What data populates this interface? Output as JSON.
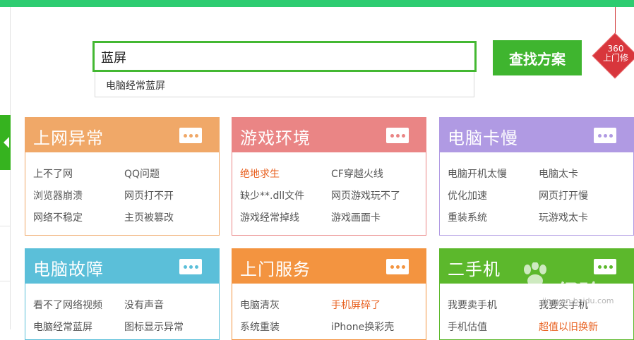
{
  "search": {
    "value": "蓝屏",
    "button_label": "查找方案",
    "suggestion": "电脑经常蓝屏"
  },
  "badge": {
    "line1": "360",
    "line2": "上门修"
  },
  "colors": {
    "accent_green": "#3fb52f",
    "card_orange": "#f0a868",
    "card_pink": "#ea8585",
    "card_purple": "#b09ae3",
    "card_blue": "#5bbfd9",
    "card_deep_orange": "#f39440",
    "card_green": "#5cb82c",
    "hot_link": "#e8601f"
  },
  "cards": [
    {
      "title": "上网异常",
      "links": [
        "上不了网",
        "QQ问题",
        "浏览器崩溃",
        "网页打不开",
        "网络不稳定",
        "主页被篡改"
      ],
      "hot": []
    },
    {
      "title": "游戏环境",
      "links": [
        "绝地求生",
        "CF穿越火线",
        "缺少**.dll文件",
        "网页游戏玩不了",
        "游戏经常掉线",
        "游戏画面卡"
      ],
      "hot": [
        0
      ]
    },
    {
      "title": "电脑卡慢",
      "links": [
        "电脑开机太慢",
        "电脑太卡",
        "优化加速",
        "网页打开慢",
        "重装系统",
        "玩游戏太卡"
      ],
      "hot": []
    },
    {
      "title": "电脑故障",
      "links": [
        "看不了网络视频",
        "没有声音",
        "电脑经常蓝屏",
        "图标显示异常"
      ],
      "hot": []
    },
    {
      "title": "上门服务",
      "links": [
        "电脑清灰",
        "手机屏碎了",
        "系统重装",
        "iPhone换彩壳"
      ],
      "hot": [
        1
      ]
    },
    {
      "title": "二手机",
      "links": [
        "我要卖手机",
        "我要买手机",
        "手机估值",
        "超值以旧换新"
      ],
      "hot": [
        3
      ]
    }
  ],
  "watermark": {
    "text": "Baidu经验",
    "sub": "jingyan.baidu.com"
  }
}
